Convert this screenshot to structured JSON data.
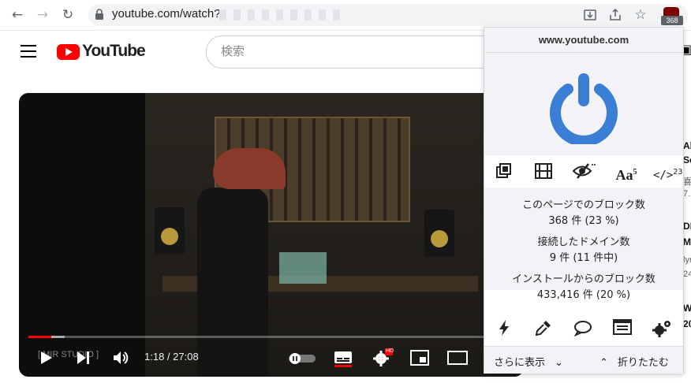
{
  "browser": {
    "url": "youtube.com/watch?",
    "ext_badge": "368"
  },
  "youtube": {
    "logo_text": "YouTube",
    "search_placeholder": "検索"
  },
  "player": {
    "current_time": "1:18",
    "separator": " / ",
    "duration": "27:08",
    "watermark": "[ MIR STUDIO ]",
    "progress_fraction": 0.047,
    "buffered_fraction": 0.075,
    "settings_badge": "HD"
  },
  "popup": {
    "domain": "www.youtube.com",
    "tools_superscripts": {
      "text_size": "5",
      "scripts": "23"
    },
    "stats": [
      {
        "label": "このページでのブロック数",
        "value": "368 件 (23 %)"
      },
      {
        "label": "接続したドメイン数",
        "value": "9 件 (11 件中)"
      },
      {
        "label": "インストールからのブロック数",
        "value": "433,416 件 (20 %)"
      }
    ],
    "more_label": "さらに表示",
    "collapse_label": "折りたたむ"
  },
  "side_column": [
    {
      "title": "Al",
      "sub": "Se"
    },
    {
      "title": "",
      "sub": "喜"
    },
    {
      "title": "",
      "sub": "7."
    },
    {
      "title": "DI",
      "sub": "M"
    },
    {
      "title": "",
      "sub": "lyr"
    },
    {
      "title": "",
      "sub": "24"
    },
    {
      "title": "W",
      "sub": "20"
    }
  ],
  "colors": {
    "youtube_red": "#ff0000",
    "power_blue": "#3a7fd5",
    "popup_bg": "#f2f2f7",
    "ext_icon": "#800000"
  }
}
